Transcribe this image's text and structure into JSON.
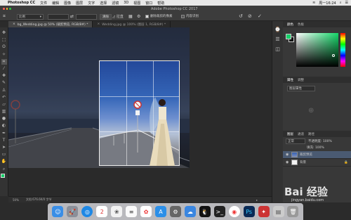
{
  "menubar": {
    "app_name": "Photoshop CC",
    "items": [
      "文件",
      "编辑",
      "图像",
      "图层",
      "文字",
      "选择",
      "滤镜",
      "3D",
      "视图",
      "窗口",
      "帮助"
    ],
    "status_right": [
      "周一16:24"
    ]
  },
  "options_bar": {
    "window_title": "Adobe Photoshop CC 2017",
    "ratio_select": "比例",
    "clear_button": "清除",
    "straighten_label": "拉直",
    "delete_cropped_label": "删除裁剪的像素",
    "content_aware_label": "内容识别"
  },
  "tabs": [
    {
      "label": "bg_Wedding.jpg @ 50% (裁剪预览, RGB/8#) *",
      "active": true
    },
    {
      "label": "Wedding.jpg @ 100% (图层 1, RGB/8#) *",
      "active": false
    }
  ],
  "status_bar": {
    "zoom": "50%",
    "doc_size": "文档:676.6K/0 字节"
  },
  "color_panel": {
    "tabs": [
      "颜色",
      "色板"
    ],
    "foreground": "#17d16a",
    "background": "#111111"
  },
  "adjust_panel": {
    "tabs": [
      "属性",
      "调整"
    ],
    "label": "图层属性"
  },
  "layers_panel": {
    "tabs": [
      "图层",
      "通道",
      "路径"
    ],
    "kind_select": "正常",
    "opacity_label": "不透明度: 100%",
    "fill_label": "填充: 100%",
    "layers": [
      {
        "name": "裁剪预览",
        "selected": true
      },
      {
        "name": "背景",
        "selected": false
      }
    ]
  },
  "watermark": {
    "text": "Bai 经验",
    "sub": "jingyan.baidu.com"
  },
  "icons": [
    "move-icon",
    "marquee-icon",
    "lasso-icon",
    "magic-wand-icon",
    "crop-icon",
    "eyedropper-icon",
    "healing-icon",
    "brush-icon",
    "stamp-icon",
    "history-brush-icon",
    "eraser-icon",
    "gradient-icon",
    "blur-icon",
    "dodge-icon",
    "pen-icon",
    "type-icon",
    "path-select-icon",
    "shape-icon",
    "hand-icon",
    "zoom-icon"
  ]
}
